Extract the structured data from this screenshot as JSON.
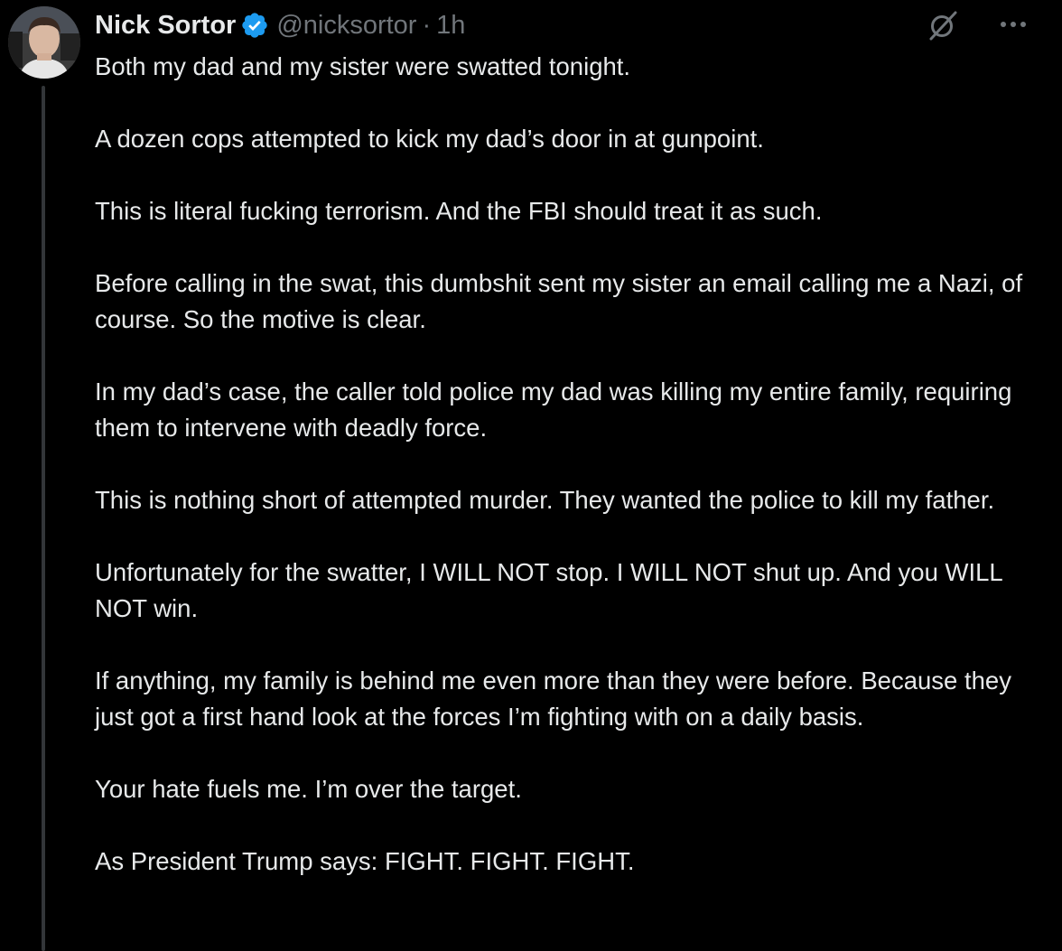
{
  "author": {
    "display_name": "Nick Sortor",
    "handle": "@nicksortor",
    "separator": "·",
    "time": "1h",
    "verified_icon": "verified-badge-icon",
    "avatar": "avatar"
  },
  "actions": {
    "grok_icon": "grok-icon",
    "more_icon": "more-options-icon"
  },
  "colors": {
    "background": "#000000",
    "text": "#e7e9ea",
    "secondary": "#71767b",
    "verified": "#1d9bf0",
    "thread_line": "#333639"
  },
  "tweet": {
    "paragraphs": [
      "Both my dad and my sister were swatted tonight.",
      "A dozen cops attempted to kick my dad’s door in at gunpoint.",
      "This is literal fucking terrorism. And the FBI should treat it as such.",
      "Before calling in the swat, this dumbshit sent my sister an email calling me a Nazi, of course. So the motive is clear.",
      "In my dad’s case, the caller told police my dad was killing my entire family, requiring them to intervene with deadly force.",
      "This is nothing short of attempted murder. They wanted the police to kill my father.",
      "Unfortunately for the swatter, I WILL NOT stop. I WILL NOT shut up. And you WILL NOT win.",
      "If anything, my family is behind me even more than they were before. Because they just got a first hand look at the forces I’m fighting with on a daily basis.",
      "Your hate fuels me. I’m over the target.",
      "As President Trump says: FIGHT. FIGHT. FIGHT."
    ]
  }
}
